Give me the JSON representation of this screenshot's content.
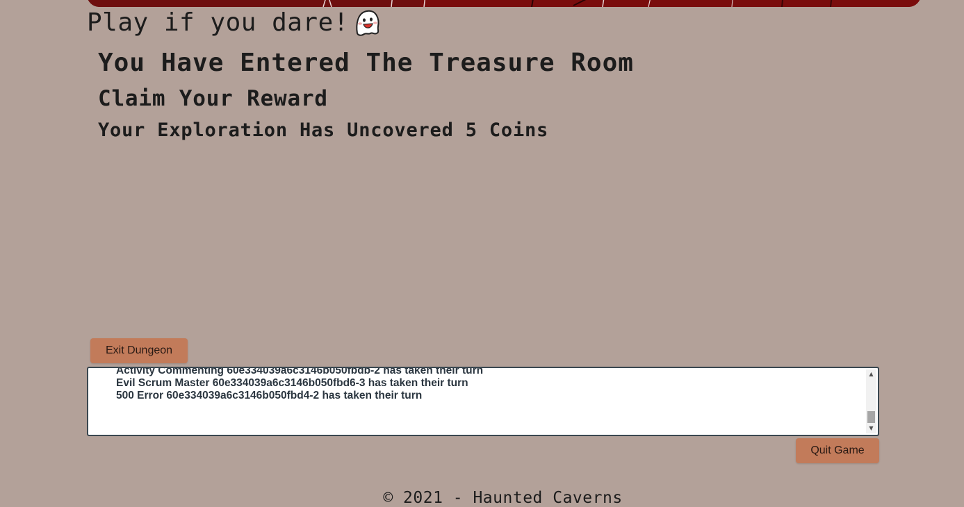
{
  "header": {
    "tagline": "Play if you dare!",
    "ghost_icon": "ghost-emoji"
  },
  "room": {
    "title": "You Have Entered The Treasure Room",
    "subtitle": "Claim Your Reward",
    "message": "Your Exploration Has Uncovered 5 Coins"
  },
  "actions": {
    "exit_label": "Exit Dungeon",
    "quit_label": "Quit Game"
  },
  "log": {
    "lines": [
      "Activity Commenting 60e334039a6c3146b050fbdb-2 has taken their turn",
      "Evil Scrum Master 60e334039a6c3146b050fbd6-3 has taken their turn",
      "500 Error 60e334039a6c3146b050fbd4-2 has taken their turn"
    ]
  },
  "footer": {
    "copyright": "© 2021 - Haunted Caverns"
  },
  "colors": {
    "background": "#b3a199",
    "banner": "#6e0f0f",
    "button": "#c27b5a",
    "log_text": "#2b3640",
    "log_border": "#3a4750"
  }
}
